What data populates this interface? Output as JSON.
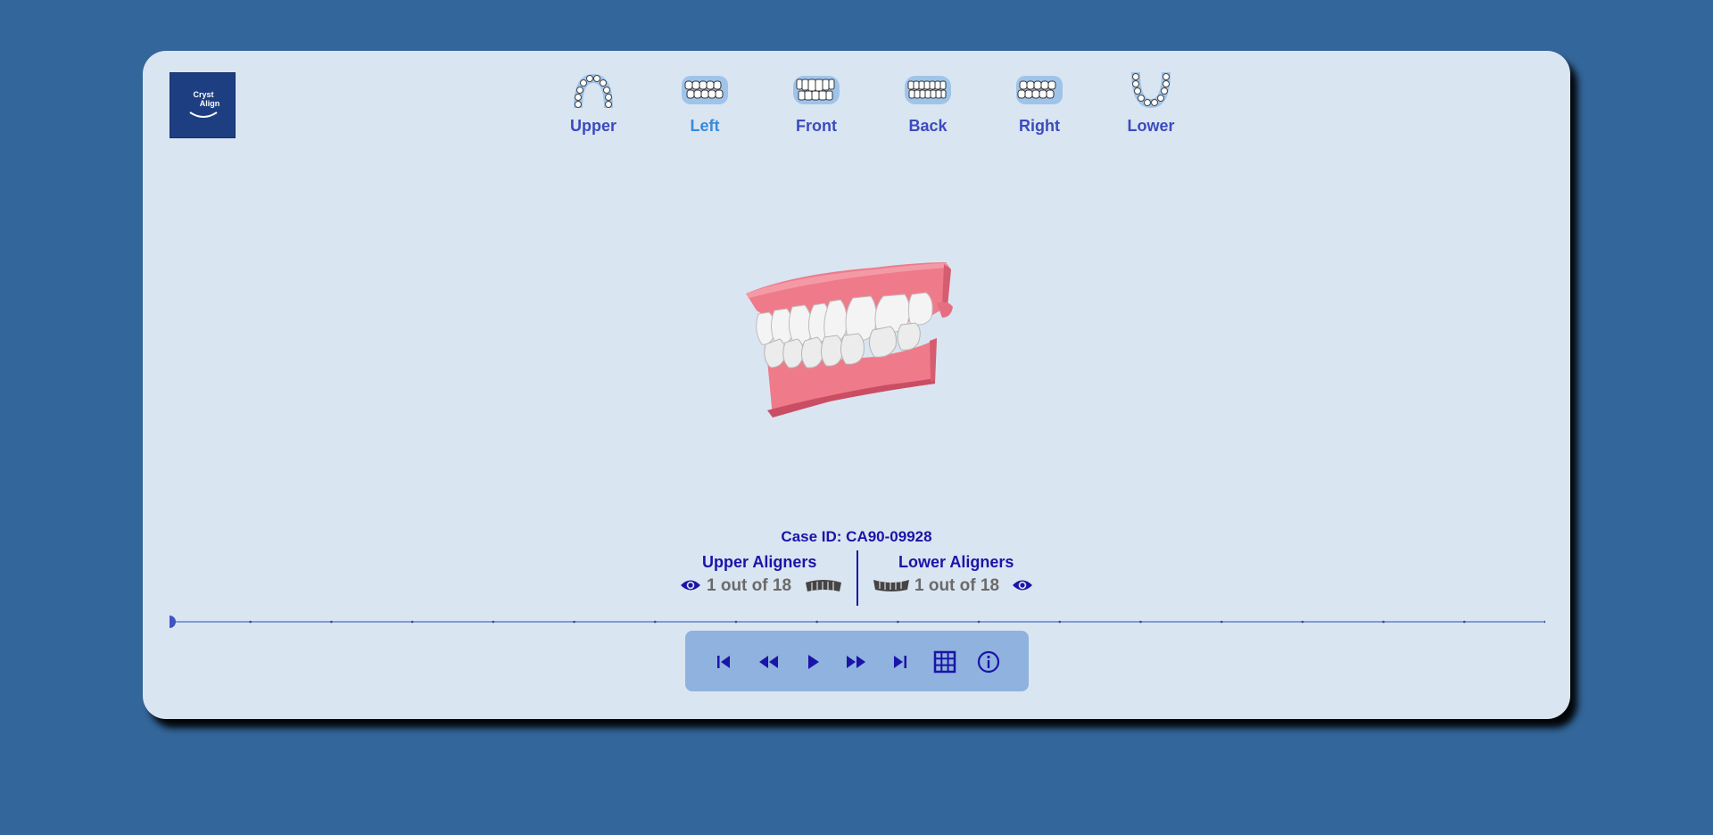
{
  "app": {
    "logo_line1": "Cryst",
    "logo_line2": "Align"
  },
  "views": [
    {
      "label": "Upper",
      "icon": "upper-arch-icon",
      "active": false
    },
    {
      "label": "Left",
      "icon": "left-teeth-icon",
      "active": true
    },
    {
      "label": "Front",
      "icon": "front-teeth-icon",
      "active": false
    },
    {
      "label": "Back",
      "icon": "back-teeth-icon",
      "active": false
    },
    {
      "label": "Right",
      "icon": "right-teeth-icon",
      "active": false
    },
    {
      "label": "Lower",
      "icon": "lower-arch-icon",
      "active": false
    }
  ],
  "case": {
    "id_text": "Case ID: CA90-09928"
  },
  "aligners": {
    "upper_title": "Upper Aligners",
    "upper_count": "1 out of 18",
    "lower_title": "Lower Aligners",
    "lower_count": "1 out of 18"
  },
  "timeline": {
    "total_steps": 18,
    "current_step": 1
  },
  "controls": [
    {
      "name": "skip-to-start-icon"
    },
    {
      "name": "rewind-icon"
    },
    {
      "name": "play-icon"
    },
    {
      "name": "fast-forward-icon"
    },
    {
      "name": "skip-to-end-icon"
    },
    {
      "name": "grid-icon"
    },
    {
      "name": "info-icon"
    }
  ],
  "colors": {
    "background": "#33669a",
    "card": "#dae5f2",
    "accent": "#1a14a8",
    "label": "#3c4bbd",
    "active_label": "#3a8ad8",
    "controls_bg": "#8fb2de",
    "gum": "#ef7b8a"
  }
}
